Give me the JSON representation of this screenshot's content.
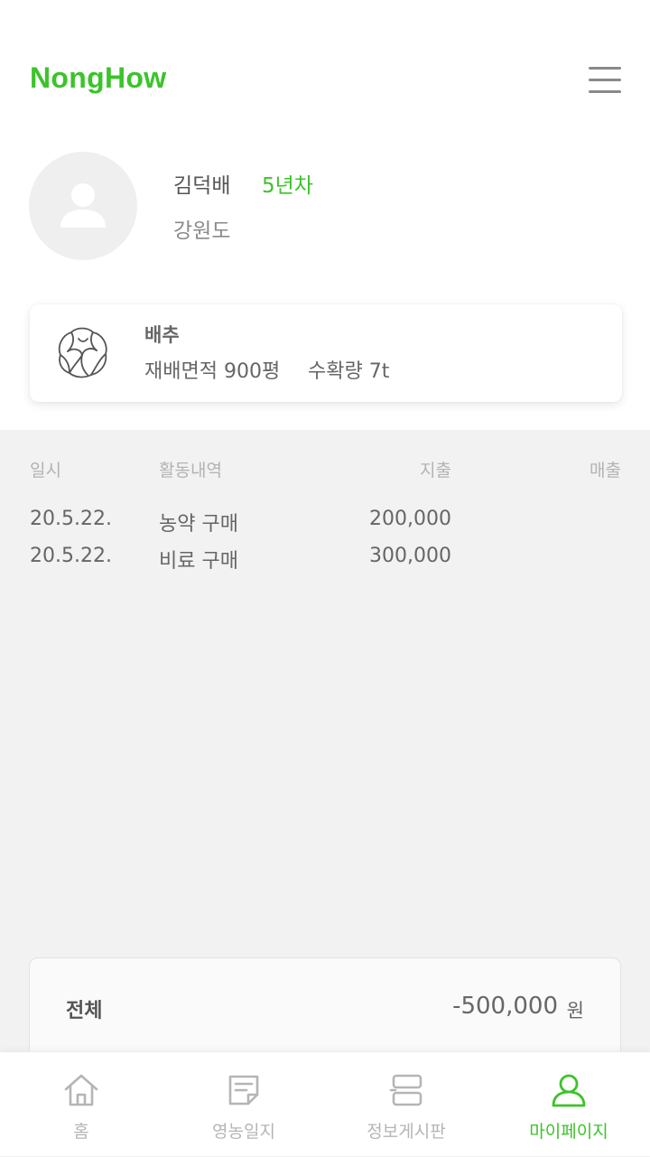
{
  "app": {
    "logo": "NongHow"
  },
  "profile": {
    "name": "김덕배",
    "years": "5년차",
    "region": "강원도"
  },
  "crop": {
    "name": "배추",
    "area": "재배면적 900평",
    "yield": "수확량 7t",
    "icon": "cabbage-icon"
  },
  "table": {
    "headers": {
      "date": "일시",
      "activity": "활동내역",
      "expense": "지출",
      "revenue": "매출"
    },
    "rows": [
      {
        "date": "20.5.22.",
        "activity": "농약 구매",
        "expense": "200,000",
        "revenue": ""
      },
      {
        "date": "20.5.22.",
        "activity": "비료 구매",
        "expense": "300,000",
        "revenue": ""
      }
    ]
  },
  "summary": {
    "label": "전체",
    "amount": "-500,000",
    "unit": "원"
  },
  "nav": {
    "items": [
      {
        "label": "홈",
        "icon": "home-icon"
      },
      {
        "label": "영농일지",
        "icon": "diary-icon"
      },
      {
        "label": "정보게시판",
        "icon": "board-icon"
      },
      {
        "label": "마이페이지",
        "icon": "user-icon"
      }
    ],
    "active_index": 3
  },
  "colors": {
    "accent": "#3cc32a",
    "background": "#f2f2f2"
  }
}
